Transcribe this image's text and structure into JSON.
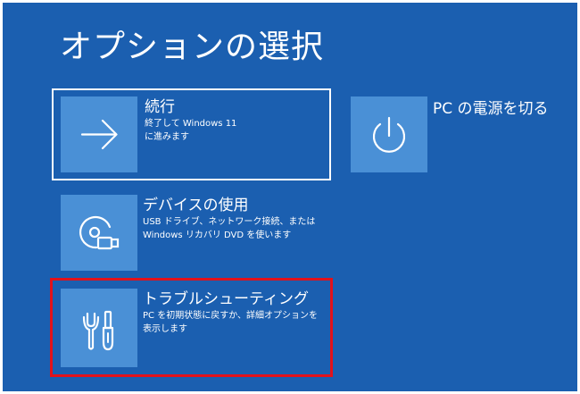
{
  "page": {
    "title": "オプションの選択"
  },
  "options": {
    "continue": {
      "title": "続行",
      "desc_line1": "終了して Windows 11",
      "desc_line2": "に進みます",
      "icon": "arrow-right-icon"
    },
    "use_device": {
      "title": "デバイスの使用",
      "desc_line1": "USB ドライブ、ネットワーク接続、または",
      "desc_line2": "Windows リカバリ DVD を使います",
      "icon": "disc-device-icon"
    },
    "troubleshoot": {
      "title": "トラブルシューティング",
      "desc_line1": "PC を初期状態に戻すか、詳細オプションを",
      "desc_line2": "表示します",
      "icon": "tools-icon",
      "highlight_color": "#e2121b"
    },
    "power_off": {
      "title": "PC の電源を切る",
      "icon": "power-icon"
    }
  },
  "colors": {
    "background": "#1b5fb0",
    "tile": "#4a90d6",
    "text": "#ffffff"
  }
}
